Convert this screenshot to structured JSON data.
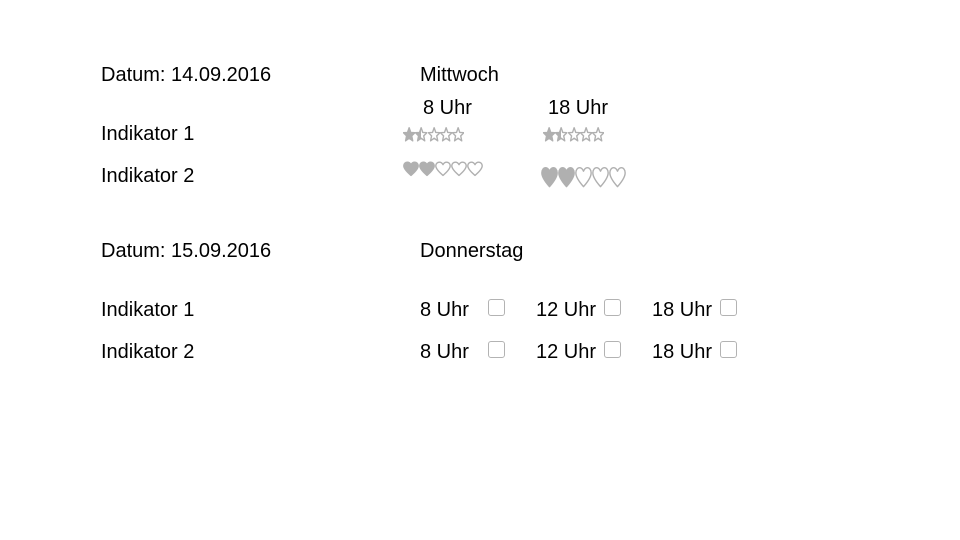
{
  "colors": {
    "text": "#000000",
    "rating_fill": "#b0b0b0",
    "rating_outline": "#b0b0b0",
    "checkbox_border": "#b3b3b3"
  },
  "day1": {
    "date_label": "Datum: 14.09.2016",
    "weekday": "Mittwoch",
    "times": [
      "8 Uhr",
      "18 Uhr"
    ],
    "indicators": [
      {
        "label": "Indikator 1",
        "rating_type": "star",
        "ratings": [
          {
            "value": 1.5,
            "max": 5
          },
          {
            "value": 1.5,
            "max": 5
          }
        ]
      },
      {
        "label": "Indikator 2",
        "rating_type": "heart",
        "ratings": [
          {
            "value": 2,
            "max": 5
          },
          {
            "value": 2,
            "max": 5
          }
        ]
      }
    ]
  },
  "day2": {
    "date_label": "Datum: 15.09.2016",
    "weekday": "Donnerstag",
    "indicators": [
      {
        "label": "Indikator 1",
        "slots": [
          {
            "time": "8 Uhr",
            "checked": false
          },
          {
            "time": "12 Uhr",
            "checked": false
          },
          {
            "time": "18 Uhr",
            "checked": false
          }
        ]
      },
      {
        "label": "Indikator 2",
        "slots": [
          {
            "time": "8 Uhr",
            "checked": false
          },
          {
            "time": "12 Uhr",
            "checked": false
          },
          {
            "time": "18 Uhr",
            "checked": false
          }
        ]
      }
    ]
  }
}
